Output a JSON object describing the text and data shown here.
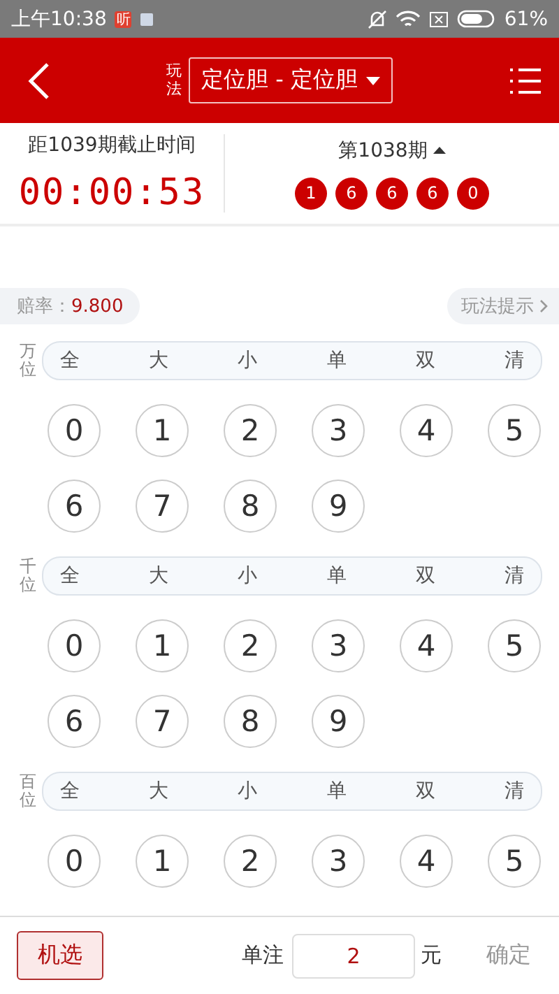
{
  "status_bar": {
    "time": "上午10:38",
    "app_badge": "听",
    "battery": "61%"
  },
  "header": {
    "play_label": "玩法",
    "play_type": "定位胆 - 定位胆"
  },
  "countdown": {
    "label": "距1039期截止时间",
    "time": "00:00:53"
  },
  "last_draw": {
    "label": "第1038期",
    "numbers": [
      "1",
      "6",
      "6",
      "6",
      "0"
    ]
  },
  "odds": {
    "label": "赔率：",
    "value": "9.800"
  },
  "hint_link": "玩法提示",
  "positions": [
    {
      "label": "万位",
      "filters": [
        "全",
        "大",
        "小",
        "单",
        "双",
        "清"
      ],
      "balls": [
        {
          "label": "0",
          "selected": false
        },
        {
          "label": "1",
          "selected": false
        },
        {
          "label": "2",
          "selected": false
        },
        {
          "label": "3",
          "selected": false
        },
        {
          "label": "4",
          "selected": false
        },
        {
          "label": "5",
          "selected": false
        },
        {
          "label": "6",
          "selected": false
        },
        {
          "label": "7",
          "selected": false
        },
        {
          "label": "8",
          "selected": false
        },
        {
          "label": "9",
          "selected": false
        }
      ]
    },
    {
      "label": "千位",
      "filters": [
        "全",
        "大",
        "小",
        "单",
        "双",
        "清"
      ],
      "balls": [
        {
          "label": "0",
          "selected": false
        },
        {
          "label": "1",
          "selected": false
        },
        {
          "label": "2",
          "selected": false
        },
        {
          "label": "3",
          "selected": false
        },
        {
          "label": "4",
          "selected": false
        },
        {
          "label": "5",
          "selected": false
        },
        {
          "label": "6",
          "selected": false
        },
        {
          "label": "7",
          "selected": false
        },
        {
          "label": "8",
          "selected": false
        },
        {
          "label": "9",
          "selected": false
        }
      ]
    },
    {
      "label": "百位",
      "filters": [
        "全",
        "大",
        "小",
        "单",
        "双",
        "清"
      ],
      "balls": [
        {
          "label": "0",
          "selected": false
        },
        {
          "label": "1",
          "selected": false
        },
        {
          "label": "2",
          "selected": false
        },
        {
          "label": "3",
          "selected": false
        },
        {
          "label": "4",
          "selected": false
        },
        {
          "label": "5",
          "selected": false
        }
      ]
    }
  ],
  "footer": {
    "random_button": "机选",
    "unit_label": "单注",
    "amount": "2",
    "currency": "元",
    "confirm": {
      "label": "确定",
      "disabled": true
    }
  }
}
